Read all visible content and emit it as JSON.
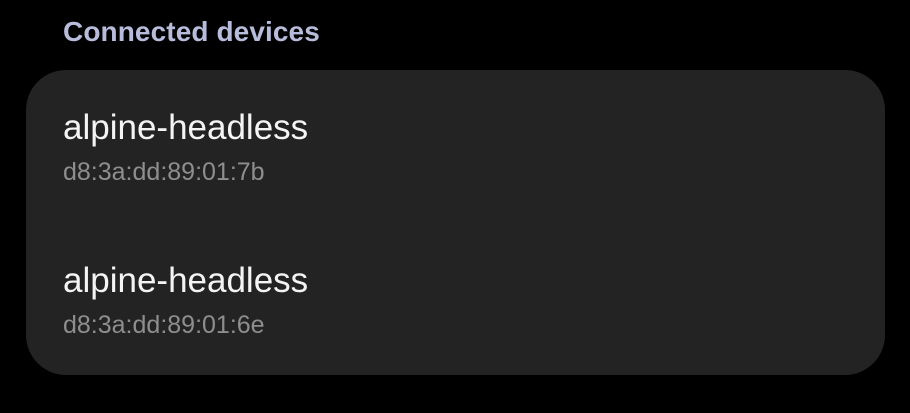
{
  "section": {
    "title": "Connected devices"
  },
  "devices": [
    {
      "name": "alpine-headless",
      "mac": "d8:3a:dd:89:01:7b"
    },
    {
      "name": "alpine-headless",
      "mac": "d8:3a:dd:89:01:6e"
    }
  ],
  "colors": {
    "background": "#000000",
    "card": "#232323",
    "section_title": "#b7bcdb",
    "primary_text": "#f4f4f4",
    "secondary_text": "#8e8e8e"
  }
}
